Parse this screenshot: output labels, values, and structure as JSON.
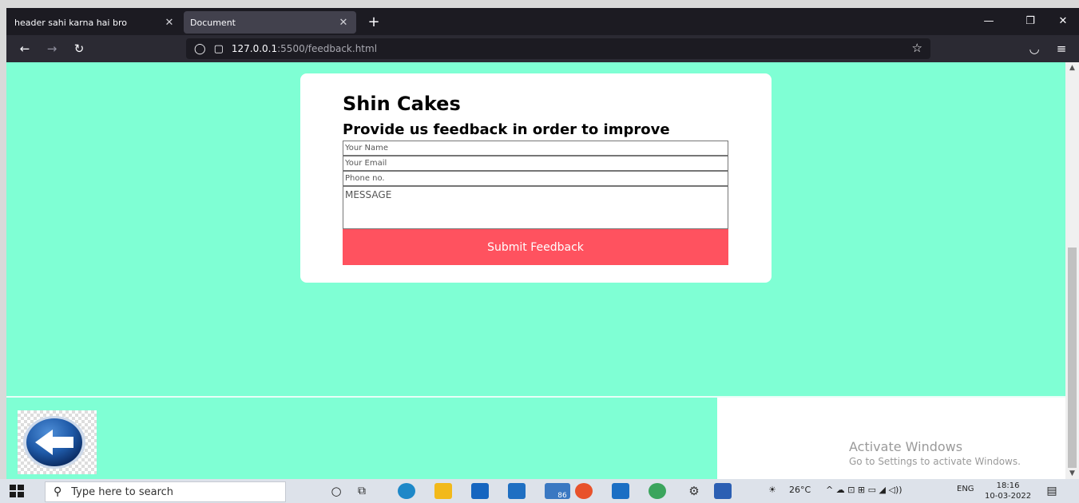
{
  "browser": {
    "tabs": [
      {
        "title": "header sahi karna hai bro",
        "close": "✕"
      },
      {
        "title": "Document",
        "close": "✕"
      }
    ],
    "new_tab": "+",
    "window_controls": {
      "minimize": "—",
      "restore": "❐",
      "close": "✕"
    },
    "nav": {
      "back": "←",
      "forward": "→",
      "reload": "↻"
    },
    "url": {
      "host": "127.0.0.1",
      "path": ":5500/feedback.html",
      "shield_icon": "◯",
      "page_icon": "▢",
      "star": "☆"
    },
    "right_icons": {
      "pocket": "◡",
      "menu": "≡"
    }
  },
  "page": {
    "title": "Shin Cakes",
    "subtitle": "Provide us feedback in order to improve",
    "form": {
      "name_placeholder": "Your Name",
      "email_placeholder": "Your Email",
      "phone_placeholder": "Phone no.",
      "message_placeholder": "MESSAGE",
      "submit_label": "Submit Feedback"
    },
    "back_icon": "back-arrow-icon"
  },
  "watermark": {
    "line1": "Activate Windows",
    "line2": "Go to Settings to activate Windows."
  },
  "taskbar": {
    "search_placeholder": "Type here to search",
    "explorer_badge": "86",
    "weather": "26°C",
    "lang": "ENG",
    "time": "18:16",
    "date": "10-03-2022",
    "tray_icons": "^ ☁ ⊡ ⊞ ▭ ◢ ◁))"
  },
  "colors": {
    "page_bg": "#7fffd4",
    "submit_bg": "#ff525f",
    "browser_dark": "#1c1b22"
  }
}
